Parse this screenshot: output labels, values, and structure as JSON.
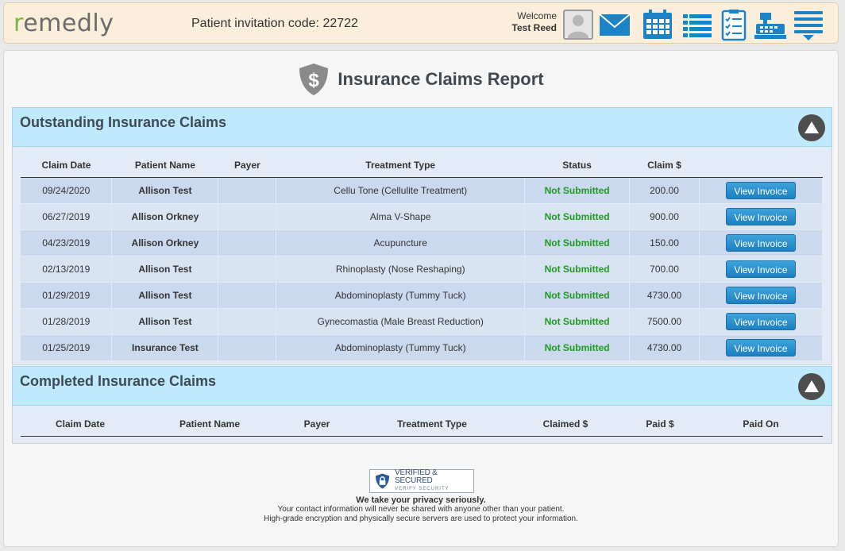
{
  "header": {
    "logo": "remedly",
    "invitation_label": "Patient invitation code: 22722",
    "welcome_label": "Welcome",
    "user_name": "Test Reed",
    "icons": [
      "avatar-icon",
      "mail-icon",
      "calendar-icon",
      "list-icon",
      "checklist-icon",
      "cash-register-icon",
      "menu-icon"
    ]
  },
  "page": {
    "title": "Insurance Claims Report"
  },
  "outstanding": {
    "title": "Outstanding Insurance Claims",
    "columns": [
      "Claim Date",
      "Patient Name",
      "Payer",
      "Treatment Type",
      "Status",
      "Claim $",
      ""
    ],
    "rows": [
      {
        "date": "09/24/2020",
        "patient": "Allison Test",
        "payer": "",
        "treatment": "Cellu Tone (Cellulite Treatment)",
        "status": "Not Submitted",
        "claim": "200.00",
        "action": "View Invoice"
      },
      {
        "date": "06/27/2019",
        "patient": "Allison Orkney",
        "payer": "",
        "treatment": "Alma V-Shape",
        "status": "Not Submitted",
        "claim": "900.00",
        "action": "View Invoice"
      },
      {
        "date": "04/23/2019",
        "patient": "Allison Orkney",
        "payer": "",
        "treatment": "Acupuncture",
        "status": "Not Submitted",
        "claim": "150.00",
        "action": "View Invoice"
      },
      {
        "date": "02/13/2019",
        "patient": "Allison Test",
        "payer": "",
        "treatment": "Rhinoplasty (Nose Reshaping)",
        "status": "Not Submitted",
        "claim": "700.00",
        "action": "View Invoice"
      },
      {
        "date": "01/29/2019",
        "patient": "Allison Test",
        "payer": "",
        "treatment": "Abdominoplasty (Tummy Tuck)",
        "status": "Not Submitted",
        "claim": "4730.00",
        "action": "View Invoice"
      },
      {
        "date": "01/28/2019",
        "patient": "Allison Test",
        "payer": "",
        "treatment": "Gynecomastia (Male Breast Reduction)",
        "status": "Not Submitted",
        "claim": "7500.00",
        "action": "View Invoice"
      },
      {
        "date": "01/25/2019",
        "patient": "Insurance Test",
        "payer": "",
        "treatment": "Abdominoplasty (Tummy Tuck)",
        "status": "Not Submitted",
        "claim": "4730.00",
        "action": "View Invoice"
      }
    ]
  },
  "completed": {
    "title": "Completed Insurance Claims",
    "columns": [
      "Claim Date",
      "Patient Name",
      "Payer",
      "Treatment Type",
      "Claimed $",
      "Paid $",
      "Paid On"
    ]
  },
  "footer": {
    "badge_line1": "VERIFIED & SECURED",
    "badge_line2": "VERIFY SECURITY",
    "privacy_title": "We take your privacy seriously.",
    "privacy_line1": "Your contact information will never be shared with anyone other than your patient.",
    "privacy_line2": "High-grade encryption and physically secure servers are used to protect your information."
  },
  "colors": {
    "accent_blue": "#1d7fc0",
    "status_green": "#1f9a1f",
    "section_header": "#bfe9fc"
  }
}
